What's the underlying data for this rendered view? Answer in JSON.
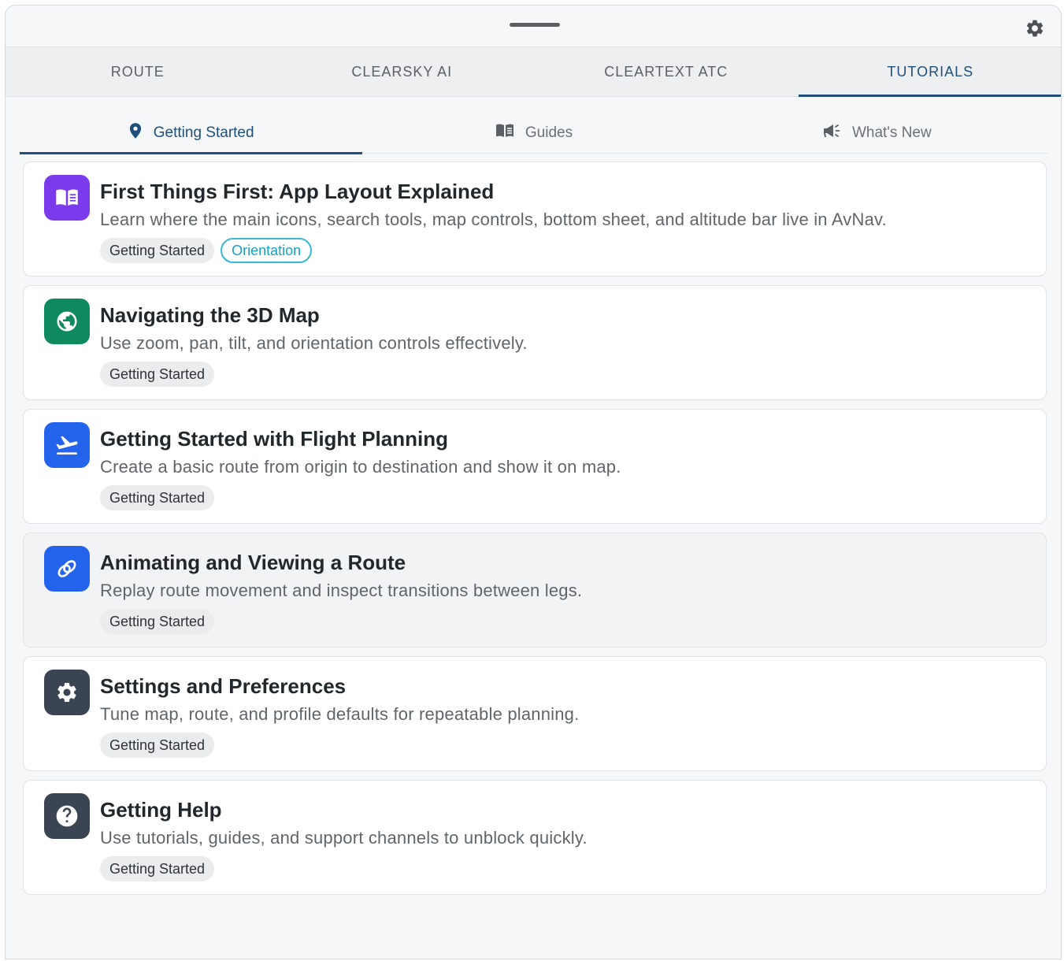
{
  "top_tabs": [
    {
      "label": "ROUTE"
    },
    {
      "label": "CLEARSKY AI"
    },
    {
      "label": "CLEARTEXT ATC"
    },
    {
      "label": "TUTORIALS"
    }
  ],
  "active_top_tab": "TUTORIALS",
  "sub_tabs": [
    {
      "label": "Getting Started",
      "icon": "map-pin-icon"
    },
    {
      "label": "Guides",
      "icon": "open-book-icon"
    },
    {
      "label": "What's New",
      "icon": "megaphone-icon"
    }
  ],
  "active_sub_tab": "Getting Started",
  "tutorials": [
    {
      "title": "First Things First: App Layout Explained",
      "description": "Learn where the main icons, search tools, map controls, bottom sheet, and altitude bar live in AvNav.",
      "tags": [
        "Getting Started",
        "Orientation"
      ],
      "icon": "book-icon",
      "icon_color": "#7c3aed"
    },
    {
      "title": "Navigating the 3D Map",
      "description": "Use zoom, pan, tilt, and orientation controls effectively.",
      "tags": [
        "Getting Started"
      ],
      "icon": "globe-icon",
      "icon_color": "#0f8a5f"
    },
    {
      "title": "Getting Started with Flight Planning",
      "description": "Create a basic route from origin to destination and show it on map.",
      "tags": [
        "Getting Started"
      ],
      "icon": "airplane-takeoff-icon",
      "icon_color": "#2463eb"
    },
    {
      "title": "Animating and Viewing a Route",
      "description": "Replay route movement and inspect transitions between legs.",
      "tags": [
        "Getting Started"
      ],
      "icon": "route-rings-icon",
      "icon_color": "#2463eb"
    },
    {
      "title": "Settings and Preferences",
      "description": "Tune map, route, and profile defaults for repeatable planning.",
      "tags": [
        "Getting Started"
      ],
      "icon": "gear-icon",
      "icon_color": "#3b4452"
    },
    {
      "title": "Getting Help",
      "description": "Use tutorials, guides, and support channels to unblock quickly.",
      "tags": [
        "Getting Started"
      ],
      "icon": "help-circle-icon",
      "icon_color": "#3b4452"
    }
  ]
}
